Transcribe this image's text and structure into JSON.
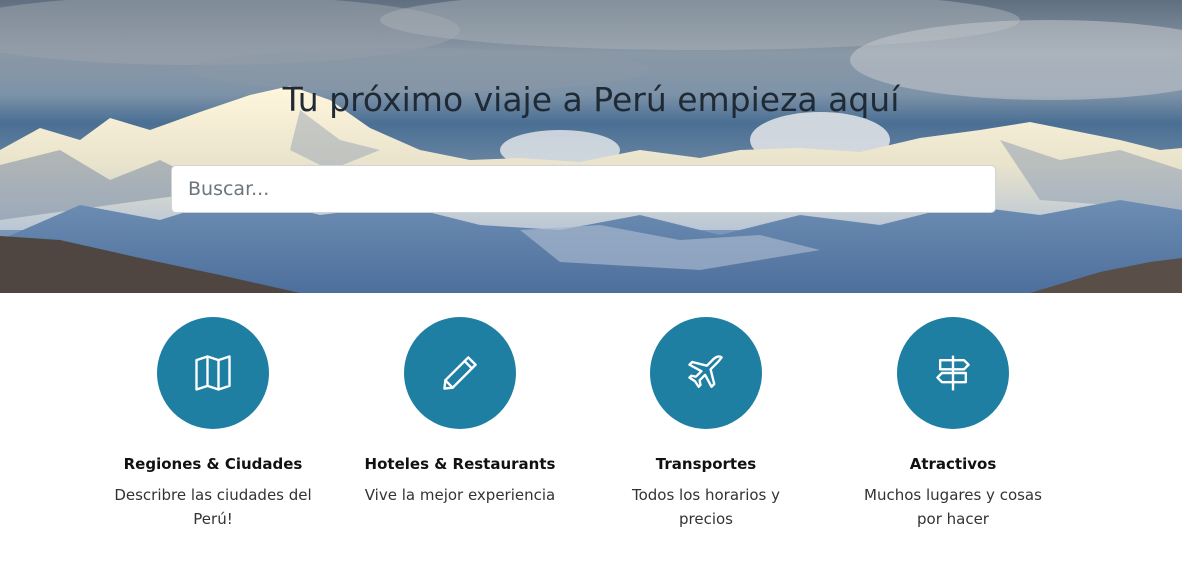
{
  "hero": {
    "title": "Tu próximo viaje a Perú empieza aquí",
    "search_placeholder": "Buscar..."
  },
  "features": [
    {
      "icon": "map-icon",
      "title": "Regiones & Ciudades",
      "description": "Describre las ciudades del Perú!"
    },
    {
      "icon": "pencil-icon",
      "title": "Hoteles & Restaurants",
      "description": "Vive la mejor experiencia"
    },
    {
      "icon": "airplane-icon",
      "title": "Transportes",
      "description": "Todos los horarios y precios"
    },
    {
      "icon": "signpost-icon",
      "title": "Atractivos",
      "description": "Muchos lugares y cosas por hacer"
    }
  ],
  "colors": {
    "accent": "#1e7fa3"
  }
}
